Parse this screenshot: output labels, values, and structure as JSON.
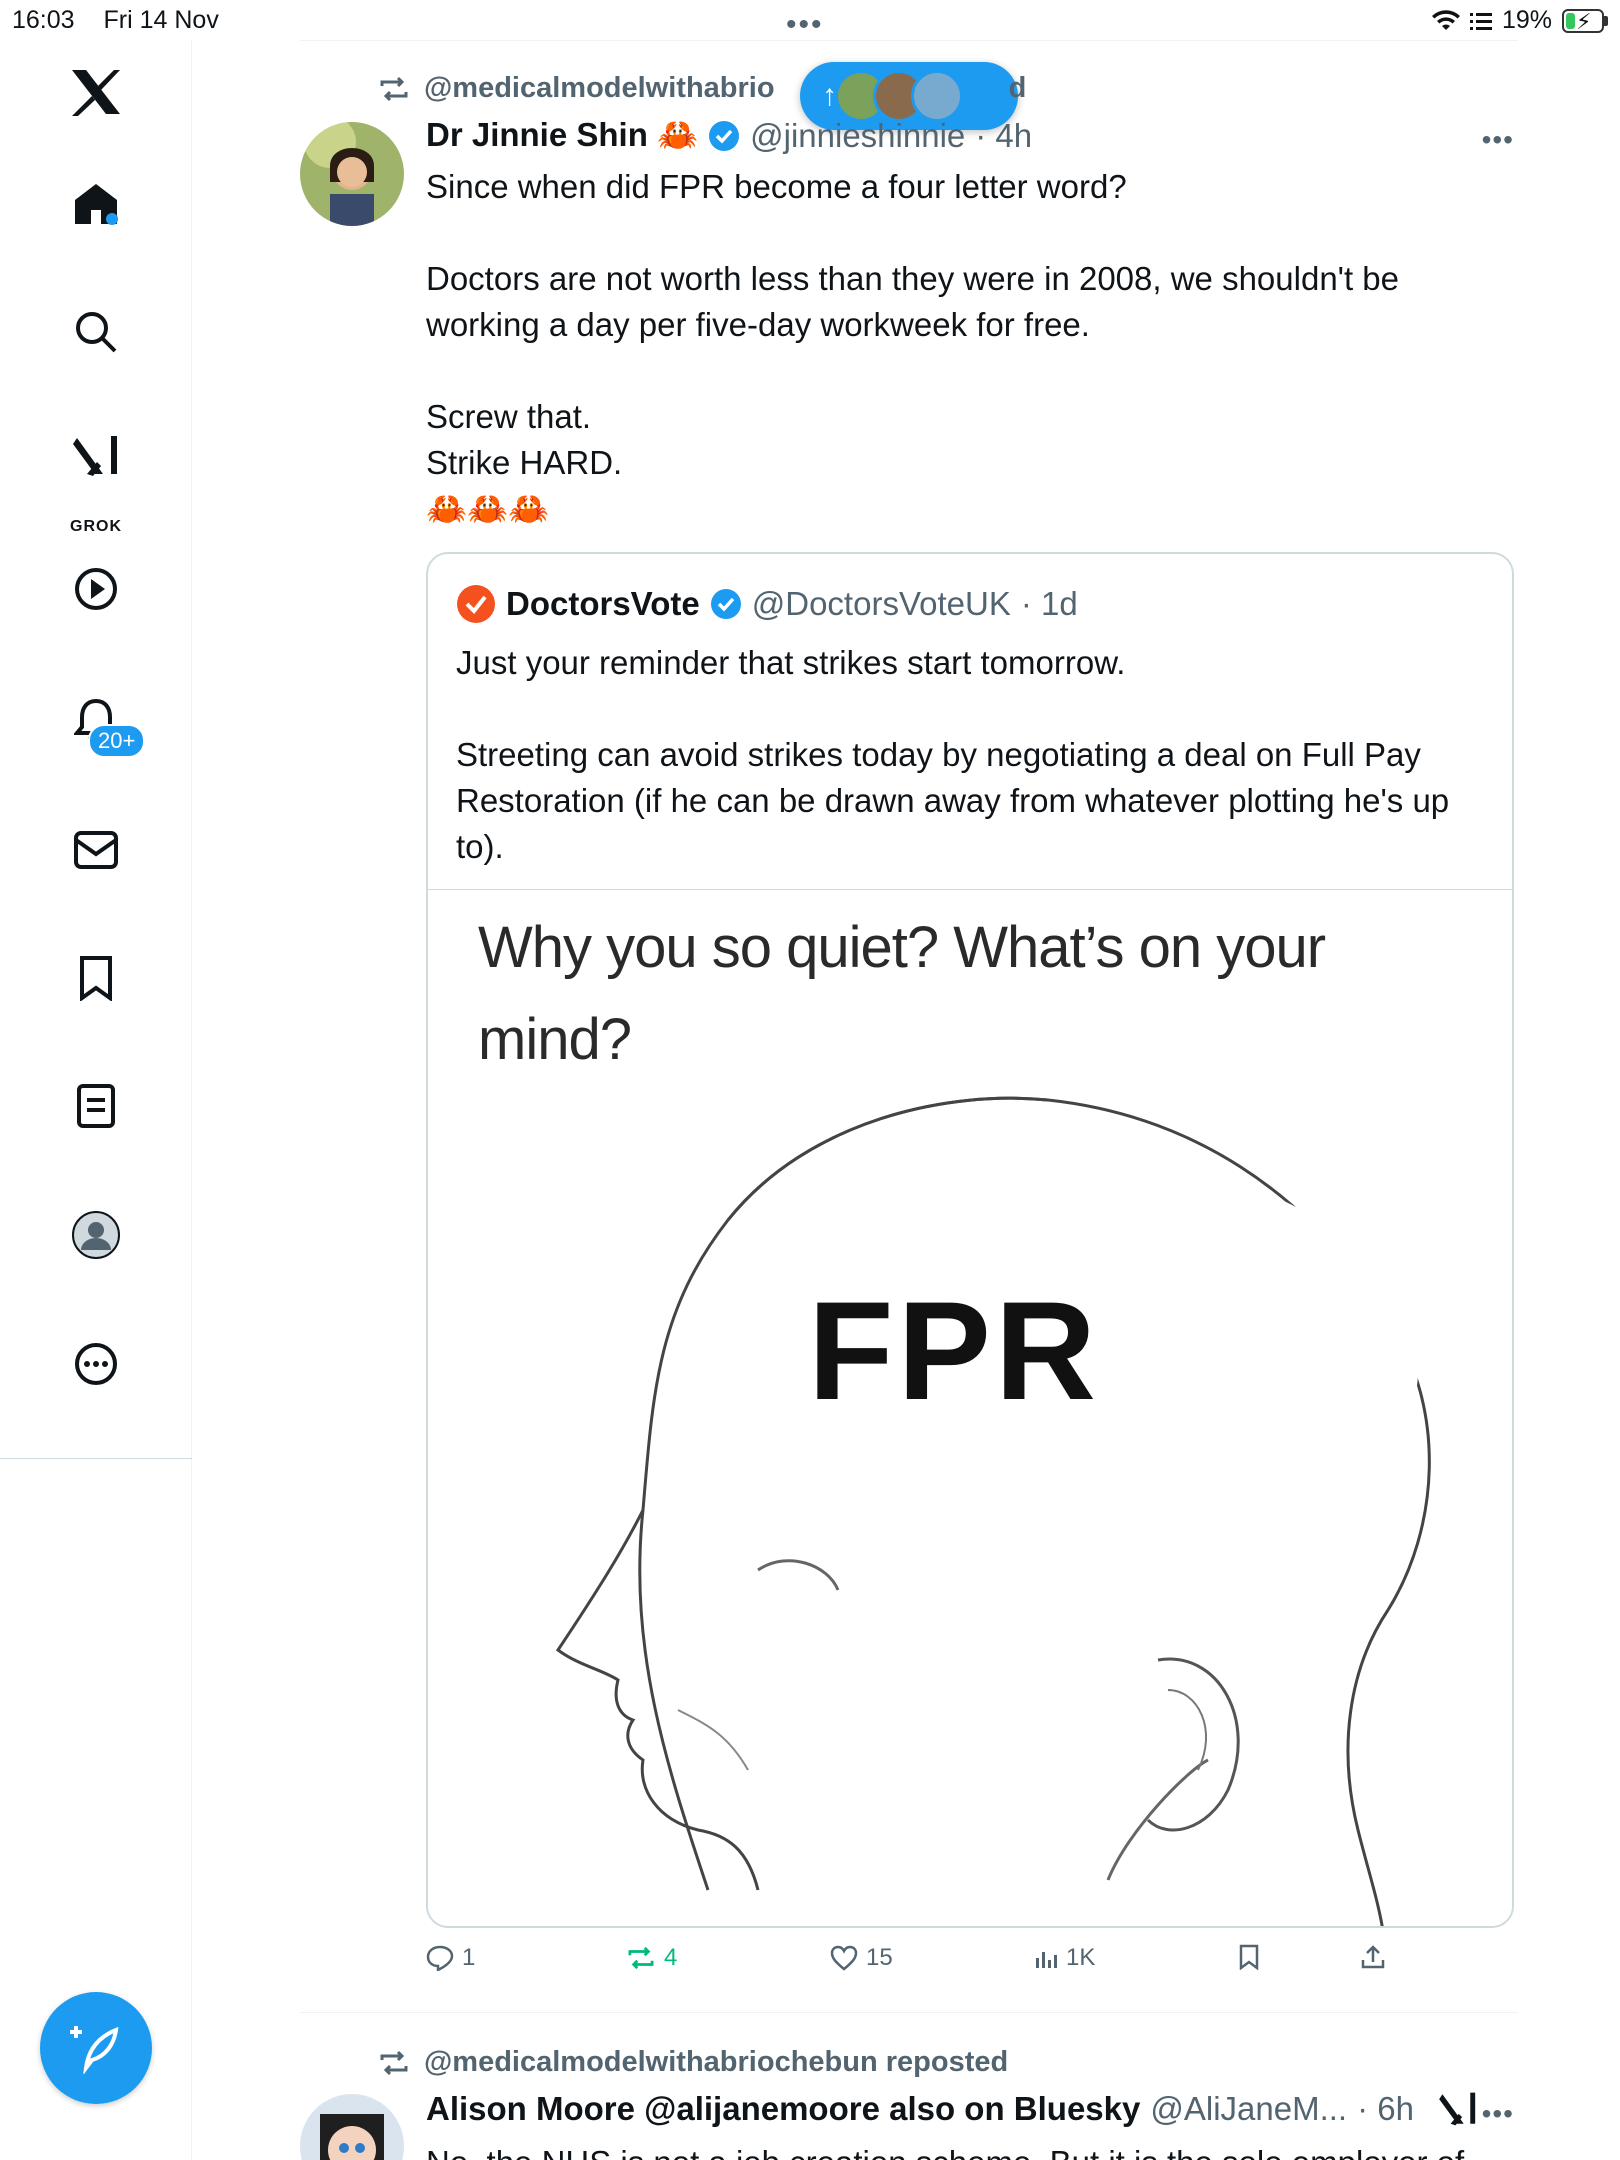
{
  "status_bar": {
    "time": "16:03",
    "date": "Fri 14 Nov",
    "battery": "19%"
  },
  "sidebar": {
    "notifications_badge": "20+",
    "grok_label": "GROK"
  },
  "new_posts_pill": {
    "arrow": "↑"
  },
  "post1": {
    "repost_label": "@medicalmodelwithabrio",
    "repost_tail": "d",
    "author_name": "Dr Jinnie Shin 🦀",
    "handle": "@jinnieshinnie",
    "time": "· 4h",
    "text": "Since when did FPR become a four letter word?\n\nDoctors are not worth less than they were in 2008, we shouldn't be working a day per five-day workweek for free.\n\nScrew that.\nStrike HARD.\n🦀🦀🦀",
    "quote": {
      "author_name": "DoctorsVote",
      "handle": "@DoctorsVoteUK",
      "time": "· 1d",
      "text": "Just your reminder that strikes start tomorrow.\n\nStreeting can avoid strikes today by negotiating a deal on Full Pay Restoration (if he can be drawn away from whatever plotting he's up to).",
      "meme_caption": "Why you so quiet? What’s on your mind?",
      "meme_word": "FPR"
    },
    "actions": {
      "replies": "1",
      "reposts": "4",
      "likes": "15",
      "views": "1K"
    }
  },
  "post2": {
    "repost_label": "@medicalmodelwithabriochebun reposted",
    "author_name": "Alison Moore @alijanemoore also on Bluesky",
    "handle": "@AliJaneM...",
    "time": "· 6h",
    "text_partial": "No, the NHS is not a job creation scheme. But it is the sole employer of"
  },
  "colors": {
    "accent": "#1d9bf0",
    "repost_green": "#00ba7c",
    "secondary_text": "#536471",
    "doctorsvote_badge": "#f4511e"
  }
}
